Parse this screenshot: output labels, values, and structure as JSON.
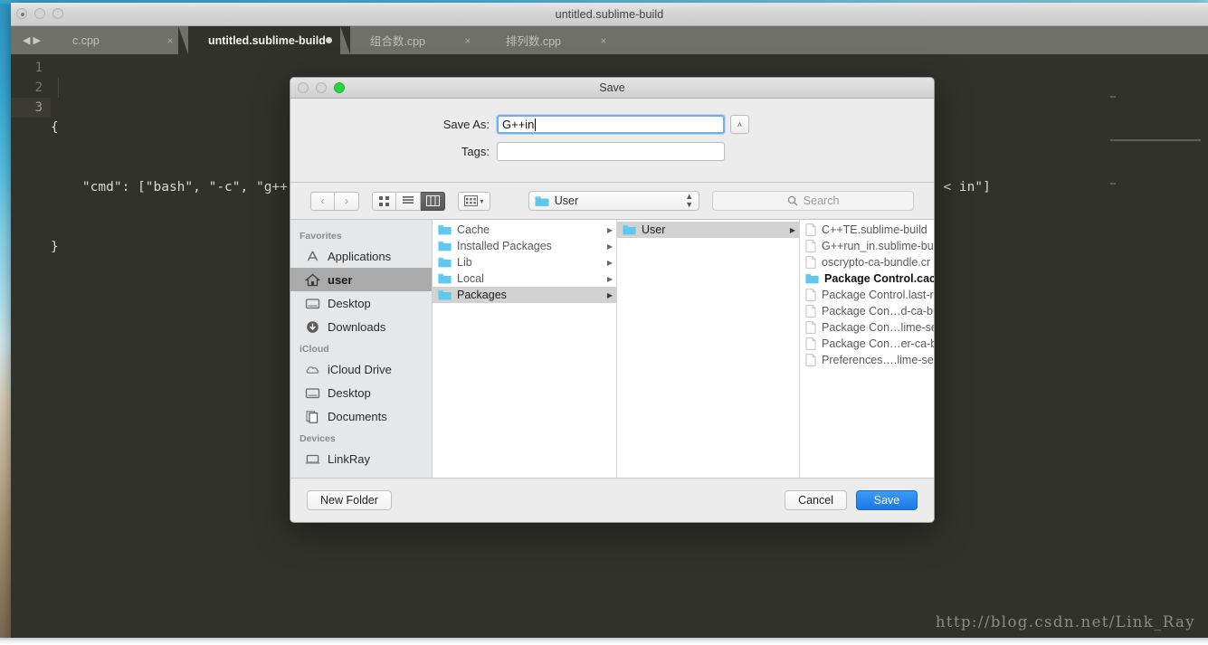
{
  "window": {
    "title": "untitled.sublime-build",
    "traffic_lights": [
      "close-dotted",
      "minimize",
      "zoom"
    ]
  },
  "tabs": [
    {
      "label": "c.cpp",
      "active": false,
      "modified": false,
      "close": "×"
    },
    {
      "label": "untitled.sublime-build",
      "active": true,
      "modified": true,
      "close": "×"
    },
    {
      "label": "组合数.cpp",
      "active": false,
      "modified": false,
      "close": "×"
    },
    {
      "label": "排列数.cpp",
      "active": false,
      "modified": false,
      "close": "×"
    }
  ],
  "editor": {
    "line_numbers": [
      "1",
      "2",
      "3"
    ],
    "lines": [
      "{",
      "    \"cmd\": [\"bash\", \"-c\", \"g++ '${file}' -o '${file_path}/${file_base_name}' && '${file_path}/${file_base_name}' < in\"]",
      "}"
    ],
    "colors": {
      "background": "#32322c",
      "text": "#dcdccc",
      "gutter_text": "#777a6d"
    }
  },
  "watermark": {
    "text": "http://blog.csdn.net/Link_Ray"
  },
  "dialog": {
    "title": "Save",
    "traffic_lights": [
      "close",
      "minimize",
      "zoom-green"
    ],
    "save_as": {
      "label": "Save As:",
      "value": "G++in",
      "placeholder": ""
    },
    "tags": {
      "label": "Tags:",
      "value": "",
      "placeholder": ""
    },
    "expand_button": "˄",
    "toolbar": {
      "back": "‹",
      "forward": "›",
      "view_icon": "icon-view",
      "view_list": "list-view",
      "view_column": "column-view",
      "arrange_label": "arrange",
      "path_label": "User",
      "path_chevron": "⌃⌄",
      "search_placeholder": "Search"
    },
    "sidebar": {
      "sections": [
        {
          "header": "Favorites",
          "items": [
            {
              "label": "Applications",
              "icon": "applications-icon",
              "selected": false
            },
            {
              "label": "user",
              "icon": "home-icon",
              "selected": true
            },
            {
              "label": "Desktop",
              "icon": "desktop-icon",
              "selected": false
            },
            {
              "label": "Downloads",
              "icon": "downloads-icon",
              "selected": false
            }
          ]
        },
        {
          "header": "iCloud",
          "items": [
            {
              "label": "iCloud Drive",
              "icon": "cloud-icon",
              "selected": false
            },
            {
              "label": "Desktop",
              "icon": "desktop-icon",
              "selected": false
            },
            {
              "label": "Documents",
              "icon": "documents-icon",
              "selected": false
            }
          ]
        },
        {
          "header": "Devices",
          "items": [
            {
              "label": "LinkRay",
              "icon": "laptop-icon",
              "selected": false
            }
          ]
        }
      ]
    },
    "columns": [
      {
        "name": "column-1",
        "rows": [
          {
            "label": "Cache",
            "type": "folder",
            "selected": false,
            "disclosure": true
          },
          {
            "label": "Installed Packages",
            "type": "folder",
            "selected": false,
            "disclosure": true
          },
          {
            "label": "Lib",
            "type": "folder",
            "selected": false,
            "disclosure": true
          },
          {
            "label": "Local",
            "type": "folder",
            "selected": false,
            "disclosure": true
          },
          {
            "label": "Packages",
            "type": "folder",
            "selected": true,
            "disclosure": true
          }
        ]
      },
      {
        "name": "column-2",
        "rows": [
          {
            "label": "User",
            "type": "folder",
            "selected": true,
            "disclosure": true
          }
        ]
      },
      {
        "name": "column-3",
        "rows": [
          {
            "label": "C++TE.sublime-build",
            "type": "file",
            "selected": false,
            "disclosure": false
          },
          {
            "label": "G++run_in.sublime-bu",
            "type": "file",
            "selected": false,
            "disclosure": false
          },
          {
            "label": "oscrypto-ca-bundle.cr",
            "type": "file",
            "selected": false,
            "disclosure": false
          },
          {
            "label": "Package Control.cache",
            "type": "folder-dark",
            "selected": false,
            "disclosure": false
          },
          {
            "label": "Package Control.last-r",
            "type": "file",
            "selected": false,
            "disclosure": false
          },
          {
            "label": "Package Con…d-ca-bu",
            "type": "file",
            "selected": false,
            "disclosure": false
          },
          {
            "label": "Package Con…lime-se",
            "type": "file",
            "selected": false,
            "disclosure": false
          },
          {
            "label": "Package Con…er-ca-b",
            "type": "file",
            "selected": false,
            "disclosure": false
          },
          {
            "label": "Preferences….lime-set",
            "type": "file",
            "selected": false,
            "disclosure": false
          }
        ]
      }
    ],
    "footer": {
      "new_folder": "New Folder",
      "cancel": "Cancel",
      "save": "Save"
    }
  },
  "colors": {
    "accent_blue": "#1878e6",
    "folder_blue": "#5ec8f0",
    "selection_gray": "#a9aaa9",
    "dialog_bg": "#ececec"
  }
}
